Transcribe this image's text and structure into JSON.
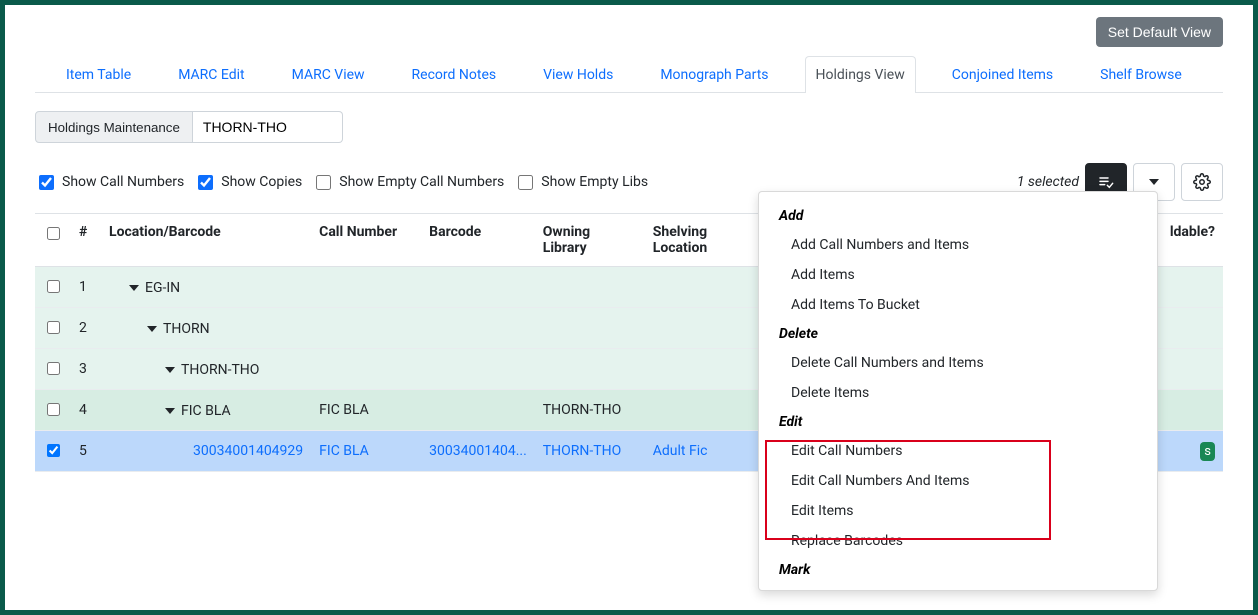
{
  "buttons": {
    "set_default_view": "Set Default View",
    "holdings_maint": "Holdings Maintenance"
  },
  "library_input": "THORN-THO",
  "tabs": [
    {
      "label": "Item Table"
    },
    {
      "label": "MARC Edit"
    },
    {
      "label": "MARC View"
    },
    {
      "label": "Record Notes"
    },
    {
      "label": "View Holds"
    },
    {
      "label": "Monograph Parts"
    },
    {
      "label": "Holdings View"
    },
    {
      "label": "Conjoined Items"
    },
    {
      "label": "Shelf Browse"
    }
  ],
  "active_tab_index": 6,
  "checks": {
    "show_call_numbers": "Show Call Numbers",
    "show_copies": "Show Copies",
    "show_empty_call": "Show Empty Call Numbers",
    "show_empty_libs": "Show Empty Libs"
  },
  "selected_text": "1 selected",
  "headers": {
    "num": "#",
    "loc": "Location/Barcode",
    "call": "Call Number",
    "barcode": "Barcode",
    "owning": "Owning Library",
    "shelving": "Shelving Location",
    "holdable": "ldable?"
  },
  "rows": [
    {
      "n": "1",
      "loc": "EG-IN",
      "indent": "indent-1",
      "cls": "row-g1",
      "toggle": true
    },
    {
      "n": "2",
      "loc": "THORN",
      "indent": "indent-2",
      "cls": "row-g1",
      "toggle": true
    },
    {
      "n": "3",
      "loc": "THORN-THO",
      "indent": "indent-3",
      "cls": "row-g1",
      "toggle": true
    },
    {
      "n": "4",
      "loc": "FIC BLA",
      "indent": "indent-3",
      "cls": "row-g2",
      "toggle": true,
      "call": "FIC BLA",
      "own": "THORN-THO"
    },
    {
      "n": "5",
      "loc": "30034001404929",
      "indent": "indent-4",
      "cls": "row-blue",
      "checked": true,
      "call": "FIC BLA",
      "barcode": "30034001404...",
      "own": "THORN-THO",
      "shelv": "Adult Fic",
      "badge": "s"
    }
  ],
  "menu": {
    "add_head": "Add",
    "add_cn_items": "Add Call Numbers and Items",
    "add_items": "Add Items",
    "add_bucket": "Add Items To Bucket",
    "del_head": "Delete",
    "del_cn_items": "Delete Call Numbers and Items",
    "del_items": "Delete Items",
    "edit_head": "Edit",
    "edit_cn": "Edit Call Numbers",
    "edit_cn_items": "Edit Call Numbers And Items",
    "edit_items": "Edit Items",
    "replace_bc": "Replace Barcodes",
    "mark_head": "Mark"
  }
}
